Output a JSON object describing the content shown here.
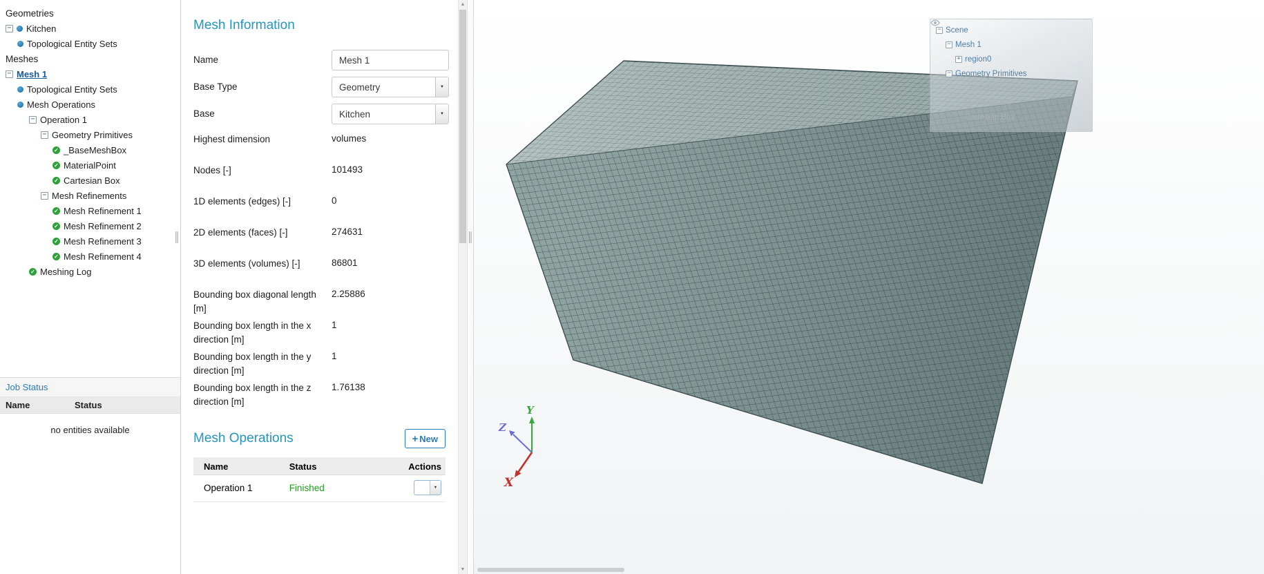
{
  "colors": {
    "accent_heading": "#2596be",
    "link_blue": "#2b7cb4",
    "selected_tree_item": "#17599c",
    "success_green": "#2fa03b",
    "status_finished": "#1f9e1f",
    "mesh_face": "#8fa3a1",
    "mesh_top_face": "#a4b6b3",
    "mesh_line": "#33424a"
  },
  "sidebar": {
    "tree": [
      {
        "label": "Geometries",
        "kind": "header",
        "level": 0
      },
      {
        "label": "Kitchen",
        "kind": "item",
        "level": 0,
        "toggle": "minus",
        "icon": "dot"
      },
      {
        "label": "Topological Entity Sets",
        "kind": "item",
        "level": 1,
        "icon": "dot"
      },
      {
        "label": "Meshes",
        "kind": "header",
        "level": 0
      },
      {
        "label": "Mesh 1",
        "kind": "selected",
        "level": 0,
        "toggle": "minus"
      },
      {
        "label": "Topological Entity Sets",
        "kind": "item",
        "level": 1,
        "icon": "dot"
      },
      {
        "label": "Mesh Operations",
        "kind": "item",
        "level": 1,
        "icon": "dot"
      },
      {
        "label": "Operation 1",
        "kind": "item",
        "level": 2,
        "toggle": "minus"
      },
      {
        "label": "Geometry Primitives",
        "kind": "item",
        "level": 3,
        "toggle": "minus"
      },
      {
        "label": "_BaseMeshBox",
        "kind": "item",
        "level": 4,
        "icon": "check"
      },
      {
        "label": "MaterialPoint",
        "kind": "item",
        "level": 4,
        "icon": "check"
      },
      {
        "label": "Cartesian Box",
        "kind": "item",
        "level": 4,
        "icon": "check"
      },
      {
        "label": "Mesh Refinements",
        "kind": "item",
        "level": 3,
        "toggle": "minus"
      },
      {
        "label": "Mesh Refinement 1",
        "kind": "item",
        "level": 4,
        "icon": "check"
      },
      {
        "label": "Mesh Refinement 2",
        "kind": "item",
        "level": 4,
        "icon": "check"
      },
      {
        "label": "Mesh Refinement 3",
        "kind": "item",
        "level": 4,
        "icon": "check"
      },
      {
        "label": "Mesh Refinement 4",
        "kind": "item",
        "level": 4,
        "icon": "check"
      },
      {
        "label": "Meshing Log",
        "kind": "item",
        "level": 2,
        "icon": "check"
      }
    ],
    "job_status": {
      "title": "Job Status",
      "columns": [
        "Name",
        "Status"
      ],
      "empty_text": "no entities available"
    }
  },
  "panel": {
    "title": "Mesh Information",
    "fields": [
      {
        "label": "Name",
        "type": "input",
        "value": "Mesh 1"
      },
      {
        "label": "Base Type",
        "type": "select",
        "value": "Geometry"
      },
      {
        "label": "Base",
        "type": "select",
        "value": "Kitchen"
      },
      {
        "label": "Highest dimension",
        "type": "static",
        "value": "volumes"
      },
      {
        "label": "Nodes [-]",
        "type": "static",
        "value": "101493"
      },
      {
        "label": "1D elements (edges) [-]",
        "type": "static",
        "value": "0"
      },
      {
        "label": "2D elements (faces) [-]",
        "type": "static",
        "value": "274631"
      },
      {
        "label": "3D elements (volumes) [-]",
        "type": "static",
        "value": "86801"
      },
      {
        "label": "Bounding box diagonal length [m]",
        "type": "static",
        "value": "2.25886"
      },
      {
        "label": "Bounding box length in the x direction [m]",
        "type": "static",
        "value": "1"
      },
      {
        "label": "Bounding box length in the y direction [m]",
        "type": "static",
        "value": "1"
      },
      {
        "label": "Bounding box length in the z direction [m]",
        "type": "static",
        "value": "1.76138"
      }
    ],
    "operations": {
      "title": "Mesh Operations",
      "new_button": "New",
      "columns": [
        "Name",
        "Status",
        "Actions"
      ],
      "rows": [
        {
          "name": "Operation 1",
          "status": "Finished"
        }
      ]
    }
  },
  "viewport": {
    "scene_tree": [
      {
        "label": "Scene",
        "level": 0,
        "toggle": "minus",
        "tone": "active"
      },
      {
        "label": "Mesh 1",
        "level": 1,
        "toggle": "minus",
        "tone": "active"
      },
      {
        "label": "region0",
        "level": 2,
        "toggle": "plus",
        "eye": true,
        "tone": "active"
      },
      {
        "label": "Geometry Primitives",
        "level": 1,
        "toggle": "minus",
        "tone": "active"
      },
      {
        "label": "_BaseMeshBox",
        "level": 3,
        "eye": true,
        "tone": "muted"
      },
      {
        "label": "MaterialPoint",
        "level": 3,
        "eye": true,
        "tone": "muted"
      },
      {
        "label": "Cartesian Box",
        "level": 3,
        "eye": true,
        "tone": "muted"
      }
    ],
    "axes": {
      "x": "X",
      "y": "Y",
      "z": "Z"
    }
  }
}
